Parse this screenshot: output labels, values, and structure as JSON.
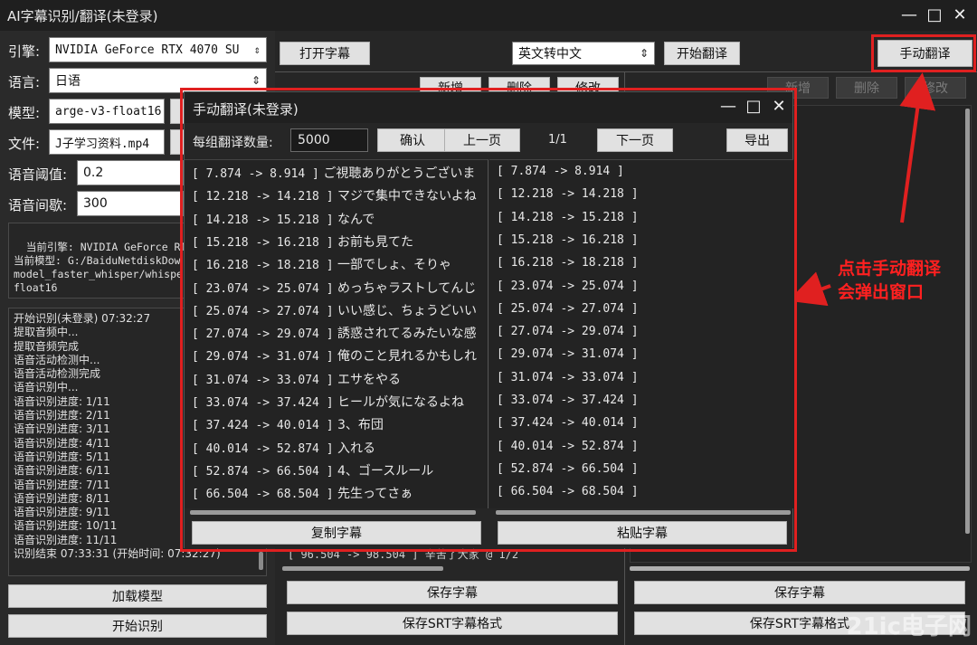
{
  "window": {
    "title": "AI字幕识别/翻译(未登录)"
  },
  "left": {
    "engine_label": "引擎:",
    "engine_value": "NVIDIA GeForce RTX 4070 SU",
    "lang_label": "语言:",
    "lang_value": "日语",
    "model_label": "模型:",
    "model_value": "arge-v3-float16",
    "file_label": "文件:",
    "file_value": "J子学习资料.mp4",
    "threshold_label": "语音阈值:",
    "threshold_value": "0.2",
    "interval_label": "语音间歇:",
    "interval_value": "300",
    "info_text": "当前引擎: NVIDIA GeForce RTX\n当前模型: G:/BaiduNetdiskDow\nmodel_faster_whisper/whisper\nfloat16",
    "log_lines": [
      "开始识别(未登录) 07:32:27",
      "提取音频中...",
      "提取音频完成",
      "语音活动检测中...",
      "语音活动检测完成",
      "语音识别中...",
      "语音识别进度: 1/11",
      "语音识别进度: 2/11",
      "语音识别进度: 3/11",
      "语音识别进度: 4/11",
      "语音识别进度: 5/11",
      "语音识别进度: 6/11",
      "语音识别进度: 7/11",
      "语音识别进度: 8/11",
      "语音识别进度: 9/11",
      "语音识别进度: 10/11",
      "语音识别进度: 11/11",
      "识别结束 07:33:31 (开始时间: 07:32:27)"
    ],
    "load_model_label": "加载模型",
    "start_recognize_label": "开始识别"
  },
  "toolbar": {
    "open_subtitle_label": "打开字幕",
    "translate_dir_value": "英文转中文",
    "start_translate_label": "开始翻译",
    "manual_translate_label": "手动翻译"
  },
  "mid": {
    "add_label": "新增",
    "delete_label": "删除",
    "modify_label": "修改",
    "bottom_peek": "[ 96.504 -> 98.504 ] 辛苦了大家 @ 1/2",
    "save_label": "保存字幕",
    "save_srt_label": "保存SRT字幕格式"
  },
  "right": {
    "add_label": "新增",
    "delete_label": "删除",
    "modify_label": "修改",
    "save_label": "保存字幕",
    "save_srt_label": "保存SRT字幕格式"
  },
  "dialog": {
    "title": "手动翻译(未登录)",
    "group_count_label": "每组翻译数量:",
    "group_count_value": "5000",
    "confirm_label": "确认",
    "prev_label": "上一页",
    "page_indicator": "1/1",
    "next_label": "下一页",
    "export_label": "导出",
    "left_rows": [
      {
        "ts": "[ 7.874 -> 8.914 ]",
        "text": "ご視聴ありがとうございま"
      },
      {
        "ts": "[ 12.218 -> 14.218 ]",
        "text": "マジで集中できないよね"
      },
      {
        "ts": "[ 14.218 -> 15.218 ]",
        "text": "なんで"
      },
      {
        "ts": "[ 15.218 -> 16.218 ]",
        "text": "お前も見てた"
      },
      {
        "ts": "[ 16.218 -> 18.218 ]",
        "text": "一部でしょ、そりゃ"
      },
      {
        "ts": "[ 23.074 -> 25.074 ]",
        "text": "めっちゃラストしてんじ"
      },
      {
        "ts": "[ 25.074 -> 27.074 ]",
        "text": "いい感じ、ちょうどいい"
      },
      {
        "ts": "[ 27.074 -> 29.074 ]",
        "text": "誘惑されてるみたいな感"
      },
      {
        "ts": "[ 29.074 -> 31.074 ]",
        "text": "俺のこと見れるかもしれ"
      },
      {
        "ts": "[ 31.074 -> 33.074 ]",
        "text": "エサをやる"
      },
      {
        "ts": "[ 33.074 -> 37.424 ]",
        "text": "ヒールが気になるよね"
      },
      {
        "ts": "[ 37.424 -> 40.014 ]",
        "text": "3、布団"
      },
      {
        "ts": "[ 40.014 -> 52.874 ]",
        "text": "入れる"
      },
      {
        "ts": "[ 52.874 -> 66.504 ]",
        "text": "4、ゴースルール"
      },
      {
        "ts": "[ 66.504 -> 68.504 ]",
        "text": "先生ってさぁ"
      }
    ],
    "right_rows": [
      {
        "ts": "[ 7.874 -> 8.914 ]"
      },
      {
        "ts": "[ 12.218 -> 14.218 ]"
      },
      {
        "ts": "[ 14.218 -> 15.218 ]"
      },
      {
        "ts": "[ 15.218 -> 16.218 ]"
      },
      {
        "ts": "[ 16.218 -> 18.218 ]"
      },
      {
        "ts": "[ 23.074 -> 25.074 ]"
      },
      {
        "ts": "[ 25.074 -> 27.074 ]"
      },
      {
        "ts": "[ 27.074 -> 29.074 ]"
      },
      {
        "ts": "[ 29.074 -> 31.074 ]"
      },
      {
        "ts": "[ 31.074 -> 33.074 ]"
      },
      {
        "ts": "[ 33.074 -> 37.424 ]"
      },
      {
        "ts": "[ 37.424 -> 40.014 ]"
      },
      {
        "ts": "[ 40.014 -> 52.874 ]"
      },
      {
        "ts": "[ 52.874 -> 66.504 ]"
      },
      {
        "ts": "[ 66.504 -> 68.504 ]"
      }
    ],
    "copy_label": "复制字幕",
    "paste_label": "粘贴字幕"
  },
  "annotation": {
    "line1": "点击手动翻译",
    "line2": "会弹出窗口"
  },
  "watermark": "21ic电子网",
  "colors": {
    "highlight": "#e02020",
    "background": "#1e1e1e",
    "button": "#e1e1e1"
  },
  "icons": [
    "minimize-icon",
    "maximize-icon",
    "close-icon",
    "chevron-updown-icon",
    "arrow-icon"
  ]
}
